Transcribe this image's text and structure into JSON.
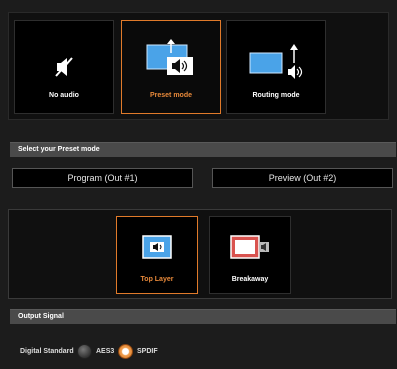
{
  "modes": [
    {
      "label": "No audio",
      "icon": "muted-speaker-icon",
      "selected": false
    },
    {
      "label": "Preset mode",
      "icon": "screen-speaker-icon",
      "selected": true
    },
    {
      "label": "Routing mode",
      "icon": "routing-icon",
      "selected": false
    }
  ],
  "preset_section": {
    "title": "Select your Preset mode"
  },
  "presets": [
    {
      "label": "Program (Out #1)"
    },
    {
      "label": "Preview (Out #2)"
    }
  ],
  "layers": [
    {
      "label": "Top Layer",
      "icon": "top-layer-icon",
      "selected": true
    },
    {
      "label": "Breakaway",
      "icon": "breakaway-icon",
      "selected": false
    }
  ],
  "output_section": {
    "title": "Output Signal"
  },
  "output": {
    "label": "Digital Standard",
    "options": [
      {
        "label": "AES3",
        "selected": false
      },
      {
        "label": "SPDIF",
        "selected": true
      }
    ]
  },
  "colors": {
    "accent": "#e07a2a",
    "screen_blue": "#4aa3e8",
    "panel": "#101010",
    "bar": "#4a4a4a"
  }
}
